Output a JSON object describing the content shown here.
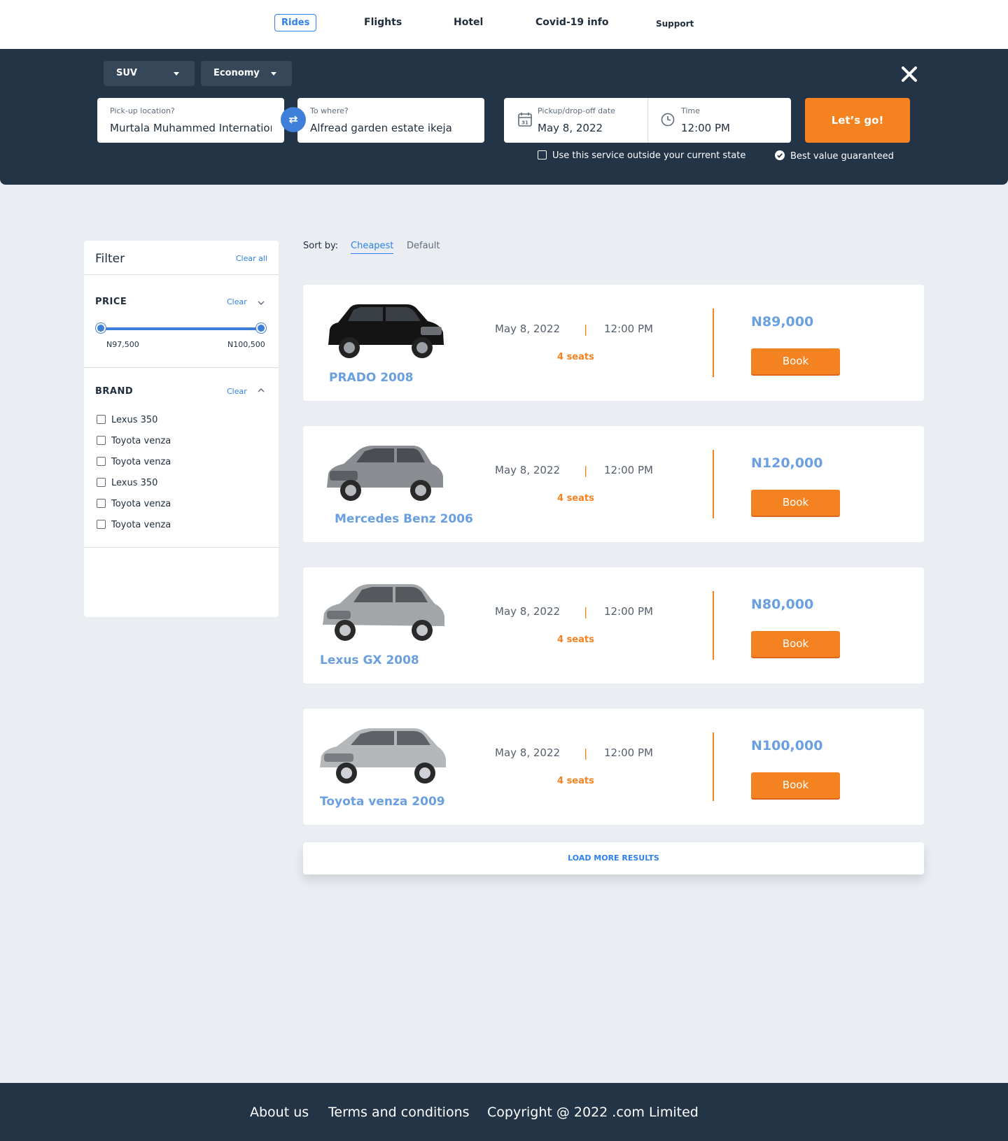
{
  "nav": {
    "items": [
      {
        "label": "Rides",
        "active": true
      },
      {
        "label": "Flights"
      },
      {
        "label": "Hotel"
      },
      {
        "label": "Covid-19 info"
      },
      {
        "label": "Support"
      }
    ]
  },
  "search": {
    "vehicle_type": "SUV",
    "class": "Economy",
    "pickup": {
      "label": "Pick-up location?",
      "value": "Murtala Muhammed International Airport"
    },
    "dropoff": {
      "label": "To where?",
      "value": "Alfread garden estate ikeja"
    },
    "date": {
      "label": "Pickup/drop-off date",
      "value": "May 8, 2022",
      "icon": "calendar-icon",
      "icon_day": "31"
    },
    "time": {
      "label": "Time",
      "value": "12:00 PM",
      "icon": "clock-icon"
    },
    "submit_label": "Let’s go!",
    "outside_state_label": "Use this service outside your current state",
    "best_value_label": "Best value guaranteed"
  },
  "filter": {
    "title": "Filter",
    "clear_all": "Clear all",
    "price": {
      "title": "PRICE",
      "clear": "Clear",
      "min_label": "N97,500",
      "max_label": "N100,500"
    },
    "brand": {
      "title": "BRAND",
      "clear": "Clear",
      "items": [
        "Lexus 350",
        "Toyota venza",
        "Toyota venza",
        "Lexus 350",
        "Toyota venza",
        "Toyota venza"
      ]
    }
  },
  "sort": {
    "label": "Sort by:",
    "options": [
      "Cheapest",
      "Default"
    ],
    "active": "Cheapest"
  },
  "results": [
    {
      "name": "PRADO 2008",
      "date": "May 8, 2022",
      "separator": "|",
      "time": "12:00 PM",
      "seats": "4 seats",
      "price": "N89,000",
      "book": "Book",
      "color": "#111111"
    },
    {
      "name": "Mercedes Benz 2006",
      "date": "May 8, 2022",
      "separator": "|",
      "time": "12:00 PM",
      "seats": "4 seats",
      "price": "N120,000",
      "book": "Book",
      "color": "#8a8d91"
    },
    {
      "name": "Lexus GX 2008",
      "date": "May 8, 2022",
      "separator": "|",
      "time": "12:00 PM",
      "seats": "4 seats",
      "price": "N80,000",
      "book": "Book",
      "color": "#a3a6a9"
    },
    {
      "name": "Toyota venza 2009",
      "date": "May 8, 2022",
      "separator": "|",
      "time": "12:00 PM",
      "seats": "4 seats",
      "price": "N100,000",
      "book": "Book",
      "color": "#b5b8bb"
    }
  ],
  "load_more": "LOAD MORE RESULTS",
  "footer": {
    "about": "About us",
    "terms": "Terms and conditions",
    "copyright": "Copyright @ 2022 .com Limited"
  },
  "colors": {
    "accent": "#f58220",
    "primary": "#2f80ed",
    "navy": "#233447",
    "price_blue": "#6a9fe0"
  }
}
